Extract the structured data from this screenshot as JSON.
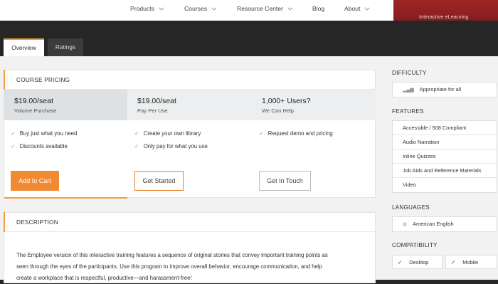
{
  "nav": {
    "items": [
      "Products",
      "Courses",
      "Resource Center",
      "Blog",
      "About"
    ],
    "banner_text": "Interactive eLearning"
  },
  "tabs": [
    "Overview",
    "Ratings"
  ],
  "pricing": {
    "heading": "COURSE PRICING",
    "columns": [
      {
        "price": "$19.00/seat",
        "sub": "Volume Purchase",
        "features": [
          "Buy just what you need",
          "Discounts available"
        ],
        "button": "Add to Cart"
      },
      {
        "price": "$19.00/seat",
        "sub": "Pay Per Use",
        "features": [
          "Create your own library",
          "Only pay for what you use"
        ],
        "button": "Get Started"
      },
      {
        "price": "1,000+ Users?",
        "sub": "We Can Help",
        "features": [
          "Request demo and pricing"
        ],
        "button": "Get In Touch"
      }
    ]
  },
  "description": {
    "heading": "DESCRIPTION",
    "lines": [
      "The Employee version of this interactive training features a sequence of original stories that convey important training points as",
      "seen through the eyes of the participants. Use this program to improve overall behavior, encourage communication, and help",
      "create a workplace that is respectful, productive—and harassment-free!"
    ]
  },
  "sidebar": {
    "difficulty": {
      "heading": "DIFFICULTY",
      "value": "Appropriate for all"
    },
    "features": {
      "heading": "FEATURES",
      "items": [
        "Accessible / 508 Compliant",
        "Audio Narration",
        "Inline Quizzes",
        "Job Aids and Reference Materials",
        "Video"
      ]
    },
    "languages": {
      "heading": "LANGUAGES",
      "value": "American English"
    },
    "compatibility": {
      "heading": "COMPATIBILITY",
      "items": [
        "Desktop",
        "Mobile"
      ]
    }
  },
  "icons": {
    "check": "check-icon",
    "chevron": "chevron-down-icon",
    "bars": "bar-chart-icon",
    "globe": "globe-icon"
  }
}
